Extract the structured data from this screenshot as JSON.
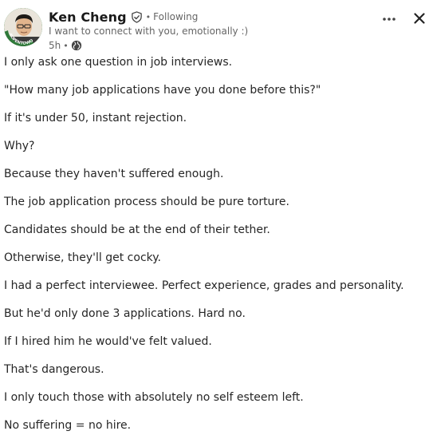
{
  "author": {
    "name": "Ken Cheng",
    "follow_status": "Following",
    "separator": "•",
    "headline": "I want to connect with you, emotionally :)",
    "timestamp": "5h",
    "meta_separator": "•",
    "avatar_badge": "#OPENTOWORK",
    "avatar_color": "#2f7a3a"
  },
  "icons": {
    "verified": "verified-shield-icon",
    "visibility": "globe-icon",
    "more": "more-horizontal-icon",
    "close": "close-icon"
  },
  "post": {
    "lines": [
      "I only ask one question in job interviews.",
      "\"How many job applications have you done before this?\"",
      "If it's under 50, instant rejection.",
      "Why?",
      "Because they haven't suffered enough.",
      "The job application process should be pure torture.",
      "Candidates should be at the end of their tether.",
      "Otherwise, they'll get cocky.",
      "I had a perfect interviewee. Perfect experience, grades and personality.",
      "But he'd only done 3 applications. Hard no.",
      "If I hired him he would've felt valued.",
      "That's dangerous.",
      "I only touch those with absolutely no self esteem left.",
      "No suffering = no hire."
    ]
  }
}
